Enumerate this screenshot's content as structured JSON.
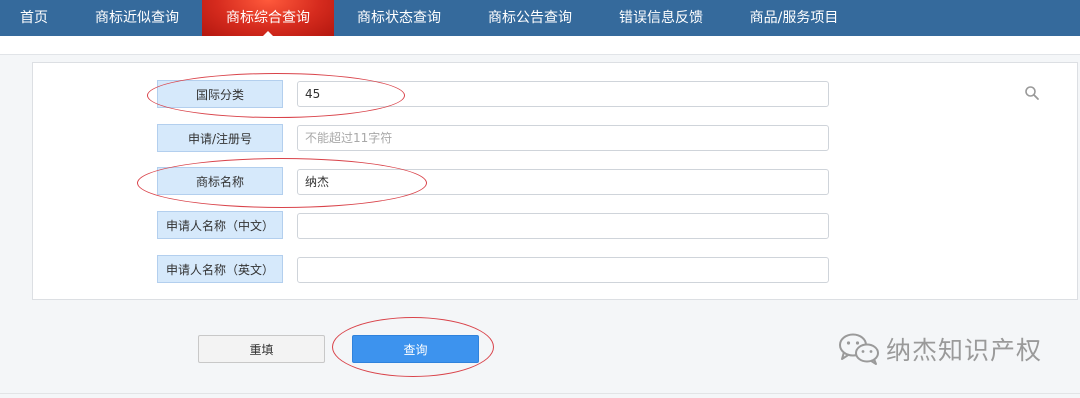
{
  "nav": {
    "items": [
      {
        "label": "首页"
      },
      {
        "label": "商标近似查询"
      },
      {
        "label": "商标综合查询"
      },
      {
        "label": "商标状态查询"
      },
      {
        "label": "商标公告查询"
      },
      {
        "label": "错误信息反馈"
      },
      {
        "label": "商品/服务项目"
      }
    ],
    "active": "商标综合查询"
  },
  "form": {
    "intl_class": {
      "label": "国际分类",
      "value": "45"
    },
    "reg_no": {
      "label": "申请/注册号",
      "value": "",
      "placeholder": "不能超过11字符"
    },
    "tm_name": {
      "label": "商标名称",
      "value": "纳杰"
    },
    "applicant_cn": {
      "label": "申请人名称（中文）",
      "value": ""
    },
    "applicant_en": {
      "label": "申请人名称（英文）",
      "value": ""
    }
  },
  "buttons": {
    "reset": "重填",
    "query": "查询"
  },
  "watermark": "纳杰知识产权",
  "icons": {
    "search": "search-icon",
    "wechat": "wechat-icon"
  },
  "colors": {
    "nav": "#356a9c",
    "active_tab": "#d62b1e",
    "label_bg": "#d6e9fb",
    "query_btn": "#3d93ee",
    "annotation": "#d9434a"
  }
}
